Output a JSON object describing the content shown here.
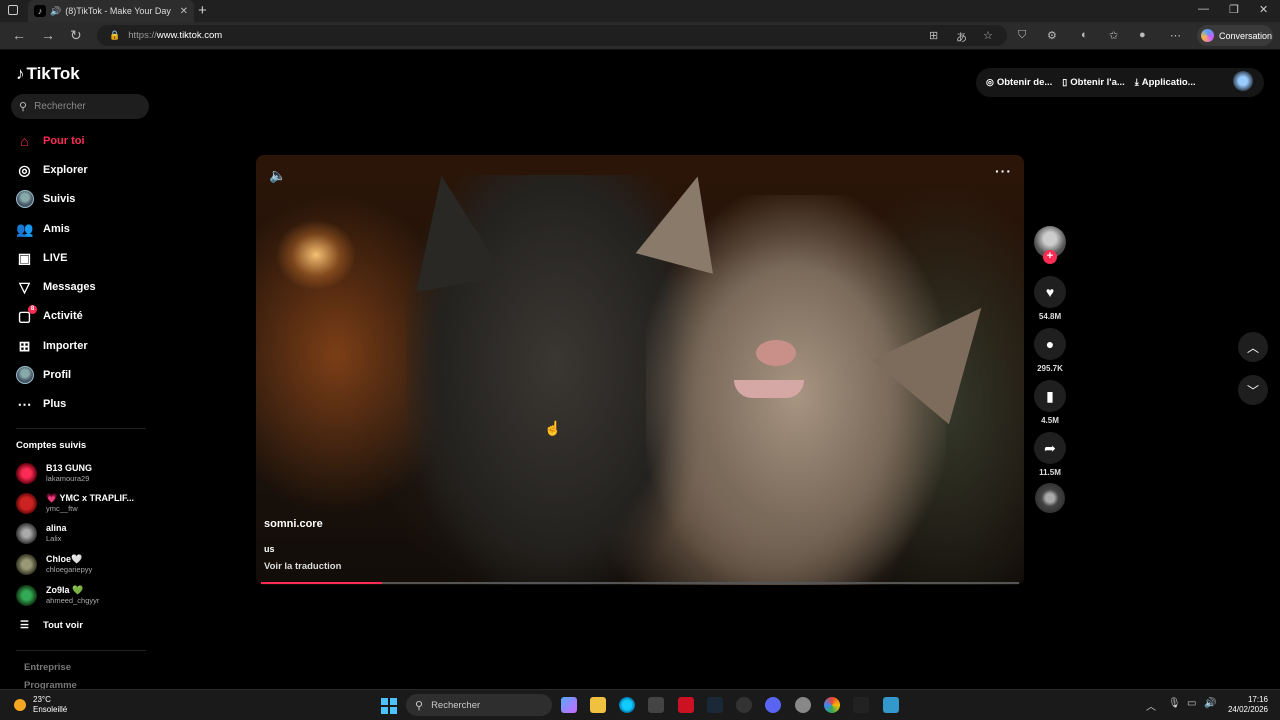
{
  "browser": {
    "tab_title": "(8)TikTok - Make Your Day",
    "url_scheme": "https://",
    "url_host": "www.tiktok.com",
    "copilot_label": "Conversation"
  },
  "app": {
    "brand": "TikTok",
    "search_placeholder": "Rechercher"
  },
  "sidebar": {
    "items": [
      {
        "label": "Pour toi",
        "icon": "home-icon"
      },
      {
        "label": "Explorer",
        "icon": "compass-icon"
      },
      {
        "label": "Suivis",
        "icon": "following-avatar-icon"
      },
      {
        "label": "Amis",
        "icon": "friends-icon"
      },
      {
        "label": "LIVE",
        "icon": "live-icon"
      },
      {
        "label": "Messages",
        "icon": "send-icon"
      },
      {
        "label": "Activité",
        "icon": "activity-icon",
        "badge": "8"
      },
      {
        "label": "Importer",
        "icon": "upload-icon"
      },
      {
        "label": "Profil",
        "icon": "profile-avatar-icon"
      },
      {
        "label": "Plus",
        "icon": "more-icon"
      }
    ],
    "following_title": "Comptes suivis",
    "accounts": [
      {
        "name": "B13 GUNG",
        "handle": "lakamoura29"
      },
      {
        "name": "💗 YMC x TRAPLIF...",
        "handle": "ymc__ftw"
      },
      {
        "name": "alina",
        "handle": "Lalix"
      },
      {
        "name": "Chloe🤍",
        "handle": "chloegariepyy"
      },
      {
        "name": "Zo9la 💚",
        "handle": "ahmeed_chgyyr"
      }
    ],
    "see_all": "Tout voir",
    "footer": [
      "Entreprise",
      "Programme"
    ]
  },
  "topbar": {
    "pills": [
      "Obtenir de...",
      "Obtenir l'a...",
      "Applicatio..."
    ]
  },
  "video": {
    "author": "somni.core",
    "description": "us",
    "translate": "Voir la traduction",
    "progress": 0.16
  },
  "actions": {
    "likes": "54.8M",
    "comments": "295.7K",
    "saves": "4.5M",
    "shares": "11.5M"
  },
  "taskbar": {
    "temp": "23°C",
    "weather": "Ensoleillé",
    "search": "Rechercher",
    "time": "17:16",
    "date": "24/02/2026"
  },
  "colors": {
    "accent": "#fe2c55",
    "background": "#000000"
  }
}
